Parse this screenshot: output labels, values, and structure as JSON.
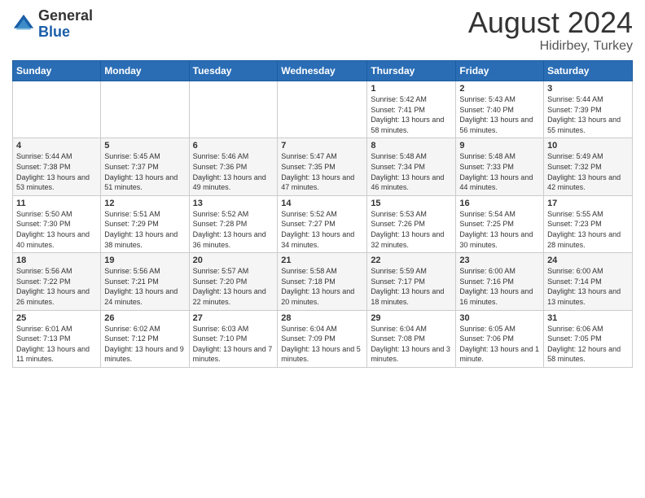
{
  "header": {
    "logo_general": "General",
    "logo_blue": "Blue",
    "month_year": "August 2024",
    "location": "Hidirbey, Turkey"
  },
  "weekdays": [
    "Sunday",
    "Monday",
    "Tuesday",
    "Wednesday",
    "Thursday",
    "Friday",
    "Saturday"
  ],
  "weeks": [
    [
      {
        "day": "",
        "sunrise": "",
        "sunset": "",
        "daylight": ""
      },
      {
        "day": "",
        "sunrise": "",
        "sunset": "",
        "daylight": ""
      },
      {
        "day": "",
        "sunrise": "",
        "sunset": "",
        "daylight": ""
      },
      {
        "day": "",
        "sunrise": "",
        "sunset": "",
        "daylight": ""
      },
      {
        "day": "1",
        "sunrise": "Sunrise: 5:42 AM",
        "sunset": "Sunset: 7:41 PM",
        "daylight": "Daylight: 13 hours and 58 minutes."
      },
      {
        "day": "2",
        "sunrise": "Sunrise: 5:43 AM",
        "sunset": "Sunset: 7:40 PM",
        "daylight": "Daylight: 13 hours and 56 minutes."
      },
      {
        "day": "3",
        "sunrise": "Sunrise: 5:44 AM",
        "sunset": "Sunset: 7:39 PM",
        "daylight": "Daylight: 13 hours and 55 minutes."
      }
    ],
    [
      {
        "day": "4",
        "sunrise": "Sunrise: 5:44 AM",
        "sunset": "Sunset: 7:38 PM",
        "daylight": "Daylight: 13 hours and 53 minutes."
      },
      {
        "day": "5",
        "sunrise": "Sunrise: 5:45 AM",
        "sunset": "Sunset: 7:37 PM",
        "daylight": "Daylight: 13 hours and 51 minutes."
      },
      {
        "day": "6",
        "sunrise": "Sunrise: 5:46 AM",
        "sunset": "Sunset: 7:36 PM",
        "daylight": "Daylight: 13 hours and 49 minutes."
      },
      {
        "day": "7",
        "sunrise": "Sunrise: 5:47 AM",
        "sunset": "Sunset: 7:35 PM",
        "daylight": "Daylight: 13 hours and 47 minutes."
      },
      {
        "day": "8",
        "sunrise": "Sunrise: 5:48 AM",
        "sunset": "Sunset: 7:34 PM",
        "daylight": "Daylight: 13 hours and 46 minutes."
      },
      {
        "day": "9",
        "sunrise": "Sunrise: 5:48 AM",
        "sunset": "Sunset: 7:33 PM",
        "daylight": "Daylight: 13 hours and 44 minutes."
      },
      {
        "day": "10",
        "sunrise": "Sunrise: 5:49 AM",
        "sunset": "Sunset: 7:32 PM",
        "daylight": "Daylight: 13 hours and 42 minutes."
      }
    ],
    [
      {
        "day": "11",
        "sunrise": "Sunrise: 5:50 AM",
        "sunset": "Sunset: 7:30 PM",
        "daylight": "Daylight: 13 hours and 40 minutes."
      },
      {
        "day": "12",
        "sunrise": "Sunrise: 5:51 AM",
        "sunset": "Sunset: 7:29 PM",
        "daylight": "Daylight: 13 hours and 38 minutes."
      },
      {
        "day": "13",
        "sunrise": "Sunrise: 5:52 AM",
        "sunset": "Sunset: 7:28 PM",
        "daylight": "Daylight: 13 hours and 36 minutes."
      },
      {
        "day": "14",
        "sunrise": "Sunrise: 5:52 AM",
        "sunset": "Sunset: 7:27 PM",
        "daylight": "Daylight: 13 hours and 34 minutes."
      },
      {
        "day": "15",
        "sunrise": "Sunrise: 5:53 AM",
        "sunset": "Sunset: 7:26 PM",
        "daylight": "Daylight: 13 hours and 32 minutes."
      },
      {
        "day": "16",
        "sunrise": "Sunrise: 5:54 AM",
        "sunset": "Sunset: 7:25 PM",
        "daylight": "Daylight: 13 hours and 30 minutes."
      },
      {
        "day": "17",
        "sunrise": "Sunrise: 5:55 AM",
        "sunset": "Sunset: 7:23 PM",
        "daylight": "Daylight: 13 hours and 28 minutes."
      }
    ],
    [
      {
        "day": "18",
        "sunrise": "Sunrise: 5:56 AM",
        "sunset": "Sunset: 7:22 PM",
        "daylight": "Daylight: 13 hours and 26 minutes."
      },
      {
        "day": "19",
        "sunrise": "Sunrise: 5:56 AM",
        "sunset": "Sunset: 7:21 PM",
        "daylight": "Daylight: 13 hours and 24 minutes."
      },
      {
        "day": "20",
        "sunrise": "Sunrise: 5:57 AM",
        "sunset": "Sunset: 7:20 PM",
        "daylight": "Daylight: 13 hours and 22 minutes."
      },
      {
        "day": "21",
        "sunrise": "Sunrise: 5:58 AM",
        "sunset": "Sunset: 7:18 PM",
        "daylight": "Daylight: 13 hours and 20 minutes."
      },
      {
        "day": "22",
        "sunrise": "Sunrise: 5:59 AM",
        "sunset": "Sunset: 7:17 PM",
        "daylight": "Daylight: 13 hours and 18 minutes."
      },
      {
        "day": "23",
        "sunrise": "Sunrise: 6:00 AM",
        "sunset": "Sunset: 7:16 PM",
        "daylight": "Daylight: 13 hours and 16 minutes."
      },
      {
        "day": "24",
        "sunrise": "Sunrise: 6:00 AM",
        "sunset": "Sunset: 7:14 PM",
        "daylight": "Daylight: 13 hours and 13 minutes."
      }
    ],
    [
      {
        "day": "25",
        "sunrise": "Sunrise: 6:01 AM",
        "sunset": "Sunset: 7:13 PM",
        "daylight": "Daylight: 13 hours and 11 minutes."
      },
      {
        "day": "26",
        "sunrise": "Sunrise: 6:02 AM",
        "sunset": "Sunset: 7:12 PM",
        "daylight": "Daylight: 13 hours and 9 minutes."
      },
      {
        "day": "27",
        "sunrise": "Sunrise: 6:03 AM",
        "sunset": "Sunset: 7:10 PM",
        "daylight": "Daylight: 13 hours and 7 minutes."
      },
      {
        "day": "28",
        "sunrise": "Sunrise: 6:04 AM",
        "sunset": "Sunset: 7:09 PM",
        "daylight": "Daylight: 13 hours and 5 minutes."
      },
      {
        "day": "29",
        "sunrise": "Sunrise: 6:04 AM",
        "sunset": "Sunset: 7:08 PM",
        "daylight": "Daylight: 13 hours and 3 minutes."
      },
      {
        "day": "30",
        "sunrise": "Sunrise: 6:05 AM",
        "sunset": "Sunset: 7:06 PM",
        "daylight": "Daylight: 13 hours and 1 minute."
      },
      {
        "day": "31",
        "sunrise": "Sunrise: 6:06 AM",
        "sunset": "Sunset: 7:05 PM",
        "daylight": "Daylight: 12 hours and 58 minutes."
      }
    ]
  ]
}
